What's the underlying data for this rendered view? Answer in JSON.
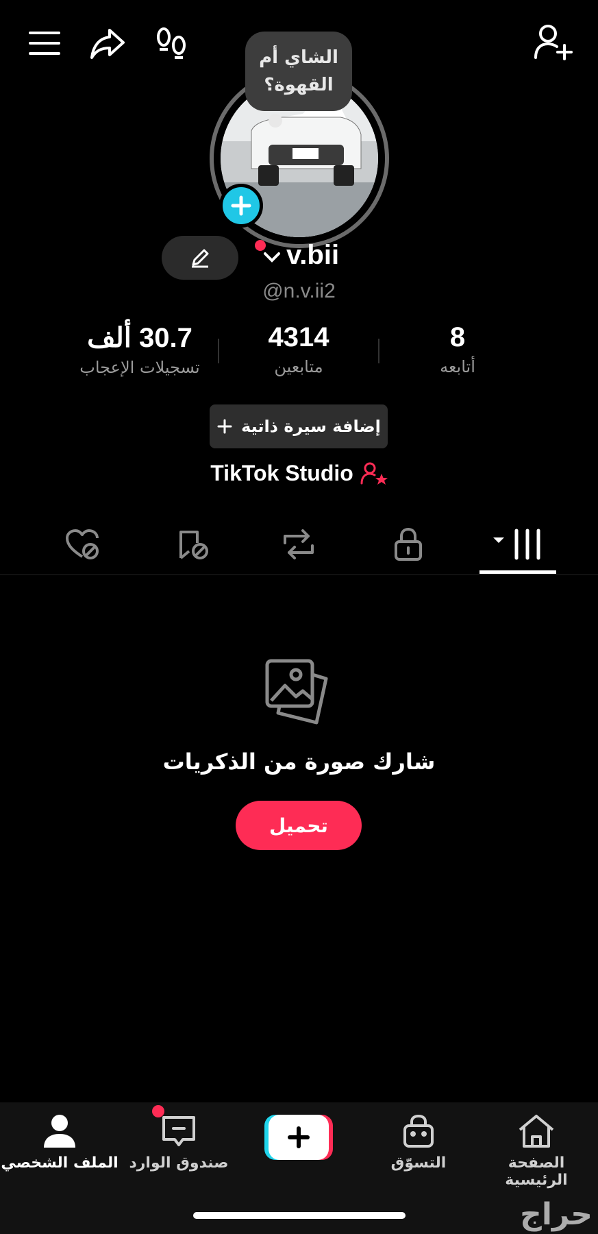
{
  "header": {
    "menu_icon": "hamburger-icon",
    "share_icon": "share-arrow-icon",
    "footprints_icon": "footprints-icon",
    "add_friend_icon": "add-user-icon"
  },
  "profile": {
    "bubble_text": "الشاي أم القهوة؟",
    "username": "v.bii",
    "handle": "@n.v.ii2"
  },
  "stats": {
    "following": {
      "value": "8",
      "label": "أتابعه"
    },
    "followers": {
      "value": "4314",
      "label": "متابعين"
    },
    "likes": {
      "value": "30.7 ألف",
      "label": "تسجيلات الإعجاب"
    }
  },
  "bio_button": {
    "label": "إضافة سيرة ذاتية",
    "icon": "plus-icon"
  },
  "studio_link": {
    "label": "TikTok Studio",
    "icon": "user-star-icon"
  },
  "tabs": [
    {
      "icon": "liked-hidden-icon"
    },
    {
      "icon": "favorites-hidden-icon"
    },
    {
      "icon": "repost-icon"
    },
    {
      "icon": "lock-icon"
    },
    {
      "icon": "grid-icon",
      "active": true
    }
  ],
  "empty_state": {
    "icon": "photos-icon",
    "title": "شارك صورة من الذكريات",
    "button_label": "تحميل"
  },
  "bottom_nav": {
    "profile": "الملف الشخصي",
    "inbox": "صندوق الوارد",
    "shop": "التسوّق",
    "home": "الصفحة الرئيسية"
  },
  "watermark": "حراج",
  "colors": {
    "accent": "#fe2c55",
    "cyan": "#20c7e6",
    "background": "#000000"
  }
}
